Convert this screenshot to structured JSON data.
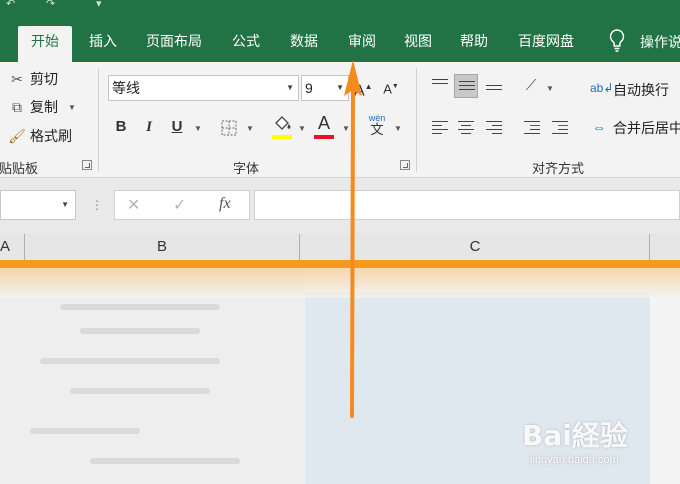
{
  "ribbon_tabs": [
    {
      "label": "开始"
    },
    {
      "label": "插入"
    },
    {
      "label": "页面布局"
    },
    {
      "label": "公式"
    },
    {
      "label": "数据"
    },
    {
      "label": "审阅"
    },
    {
      "label": "视图"
    },
    {
      "label": "帮助"
    },
    {
      "label": "百度网盘"
    }
  ],
  "tell_me": "操作说",
  "clipboard": {
    "cut": "剪切",
    "copy": "复制",
    "format_painter": "格式刷",
    "group_label": "贴贴板"
  },
  "font": {
    "name": "等线",
    "size": "9",
    "grow": "A",
    "shrink": "A",
    "bold": "B",
    "italic": "I",
    "underline": "U",
    "font_color_glyph": "A",
    "phonetic": "wén",
    "phonetic_base": "文",
    "group_label": "字体",
    "font_color": "#e81123",
    "highlight_color": "#ffff00"
  },
  "alignment": {
    "wrap_text": "自动换行",
    "merge_center": "合并后居中",
    "group_label": "对齐方式"
  },
  "formula_bar": {
    "cancel": "✕",
    "enter": "✓",
    "fx": "fx"
  },
  "columns": [
    "A",
    "B",
    "C"
  ],
  "colors": {
    "excel_green": "#217346",
    "arrow_orange": "#f58a1f",
    "header_orange": "#f59a1e"
  },
  "watermark": {
    "logo": "Bai経验",
    "url": "jingyan.baidu.com"
  }
}
